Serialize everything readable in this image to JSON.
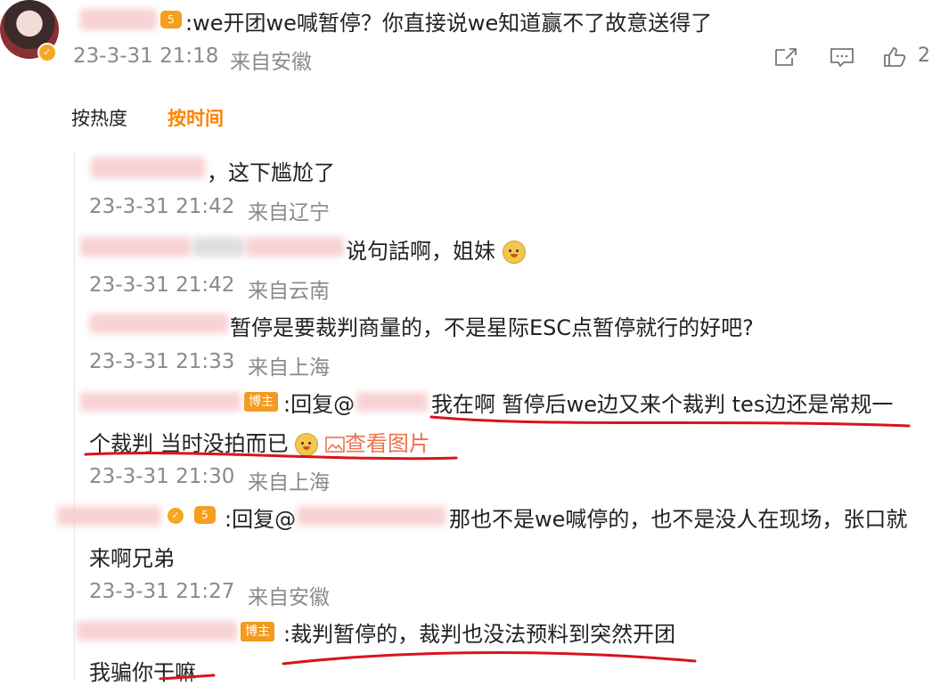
{
  "post": {
    "crown_badge": "5",
    "text": ":we开团we喊暂停？你直接说we知道赢不了故意送得了",
    "time": "23-3-31 21:18",
    "location": "来自安徽",
    "like_count": "2"
  },
  "tabs": [
    {
      "label": "按热度"
    },
    {
      "label": "按时间"
    }
  ],
  "replies": [
    {
      "text": "，这下尴尬了",
      "time": "23-3-31 21:42",
      "location": "来自辽宁"
    },
    {
      "text": "说句話啊，姐妹",
      "time": "23-3-31 21:42",
      "location": "来自云南"
    },
    {
      "text": "暂停是要裁判商量的，不是星际ESC点暂停就行的好吧?",
      "time": "23-3-31 21:33",
      "location": "来自上海"
    },
    {
      "badge": "博主",
      "prefix": ":回复@",
      "text": "我在啊  暂停后we边又来个裁判 tes边还是常规一",
      "text2": "个裁判 当时没拍而已",
      "link": "查看图片",
      "time": "23-3-31 21:30",
      "location": "来自上海"
    },
    {
      "prefix": ":回复@",
      "text": "那也不是we喊停的，也不是没人在现场，张口就",
      "text2": "来啊兄弟",
      "time": "23-3-31 21:27",
      "location": "来自安徽"
    },
    {
      "badge": "博主",
      "text": ":裁判暂停的，裁判也没法预料到突然开团",
      "text2": "我骗你干嘛"
    }
  ],
  "colors": {
    "accent": "#ff8200",
    "link": "#eb7350",
    "underline": "#d8141c"
  }
}
